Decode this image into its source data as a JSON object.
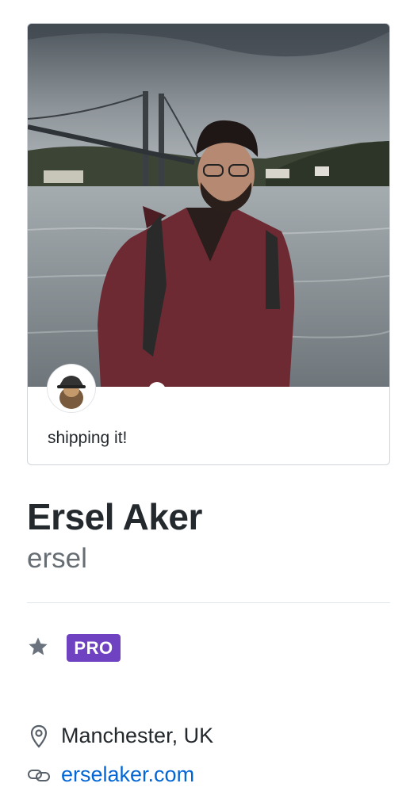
{
  "status": {
    "message": "shipping it!"
  },
  "profile": {
    "name": "Ersel Aker",
    "login": "ersel"
  },
  "badges": {
    "star_icon": "star-icon",
    "pro_label": "PRO",
    "pro_color": "#6f42c1"
  },
  "details": {
    "location": {
      "icon": "location-pin-icon",
      "text": "Manchester, UK"
    },
    "website": {
      "icon": "link-icon",
      "text": "erselaker.com"
    }
  },
  "colors": {
    "text": "#24292e",
    "muted": "#666d73",
    "link": "#0366d6",
    "border": "#d1d5da"
  }
}
